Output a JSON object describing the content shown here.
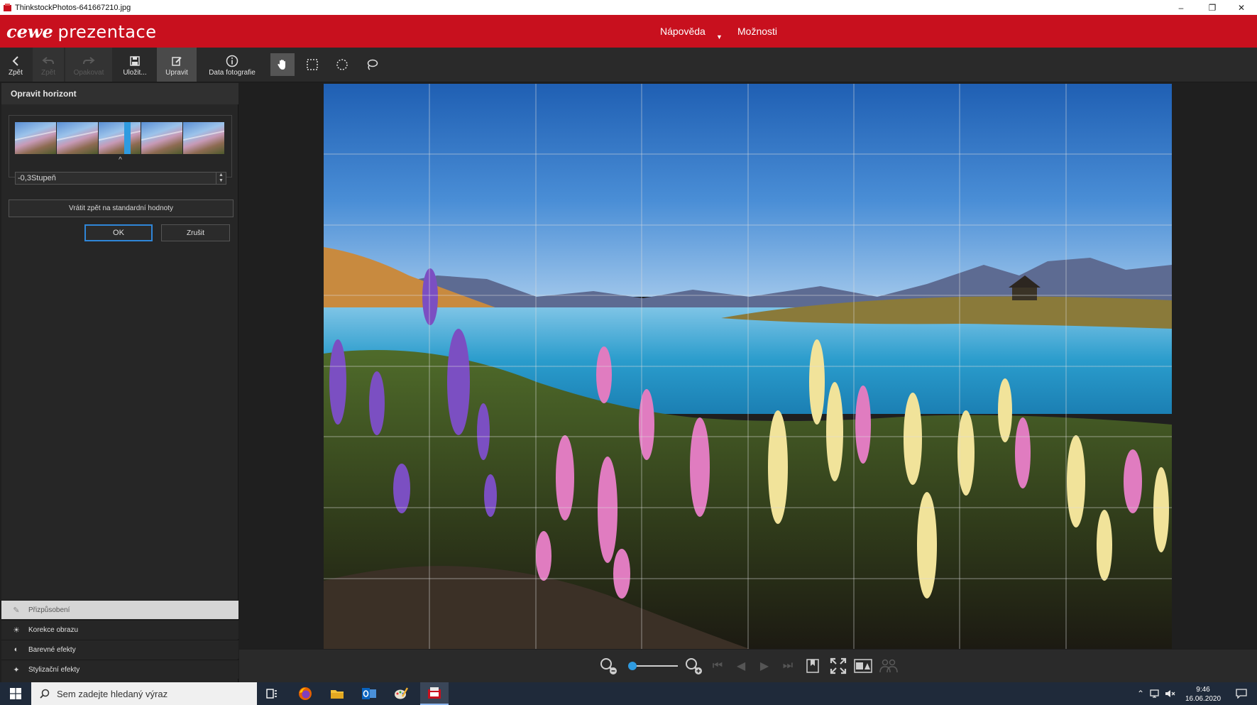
{
  "window": {
    "title": "ThinkstockPhotos-641667210.jpg",
    "minimize": "–",
    "restore": "❐",
    "close": "✕"
  },
  "header": {
    "logo_brand": "cewe",
    "logo_product": "prezentace",
    "menu": {
      "help": "Nápověda",
      "options": "Možnosti"
    }
  },
  "toolbar": {
    "back": "Zpět",
    "undo": "Zpět",
    "redo": "Opakovat",
    "save": "Uložit...",
    "edit": "Upravit",
    "photo_data": "Data fotografie"
  },
  "panel": {
    "title": "Opravit horizont",
    "marker": "^",
    "angle_value": "-0,3Stupeň",
    "reset_label": "Vrátit zpět na standardní hodnoty",
    "ok_label": "OK",
    "cancel_label": "Zrušit",
    "sections": [
      {
        "label": "Přizpůsobení",
        "icon": "adjust-icon",
        "selected": true
      },
      {
        "label": "Korekce obrazu",
        "icon": "sun-icon",
        "selected": false
      },
      {
        "label": "Barevné efekty",
        "icon": "color-icon",
        "selected": false
      },
      {
        "label": "Stylizační efekty",
        "icon": "style-icon",
        "selected": false
      }
    ]
  },
  "zoom": {
    "level": 0.03
  },
  "taskbar": {
    "search_placeholder": "Sem zadejte hledaný výraz",
    "time": "9:46",
    "date": "16.06.2020"
  },
  "colors": {
    "brand_red": "#c8101e",
    "accent_blue": "#2f9be0",
    "toolbar": "#2a2a2a",
    "panel": "#262626"
  }
}
